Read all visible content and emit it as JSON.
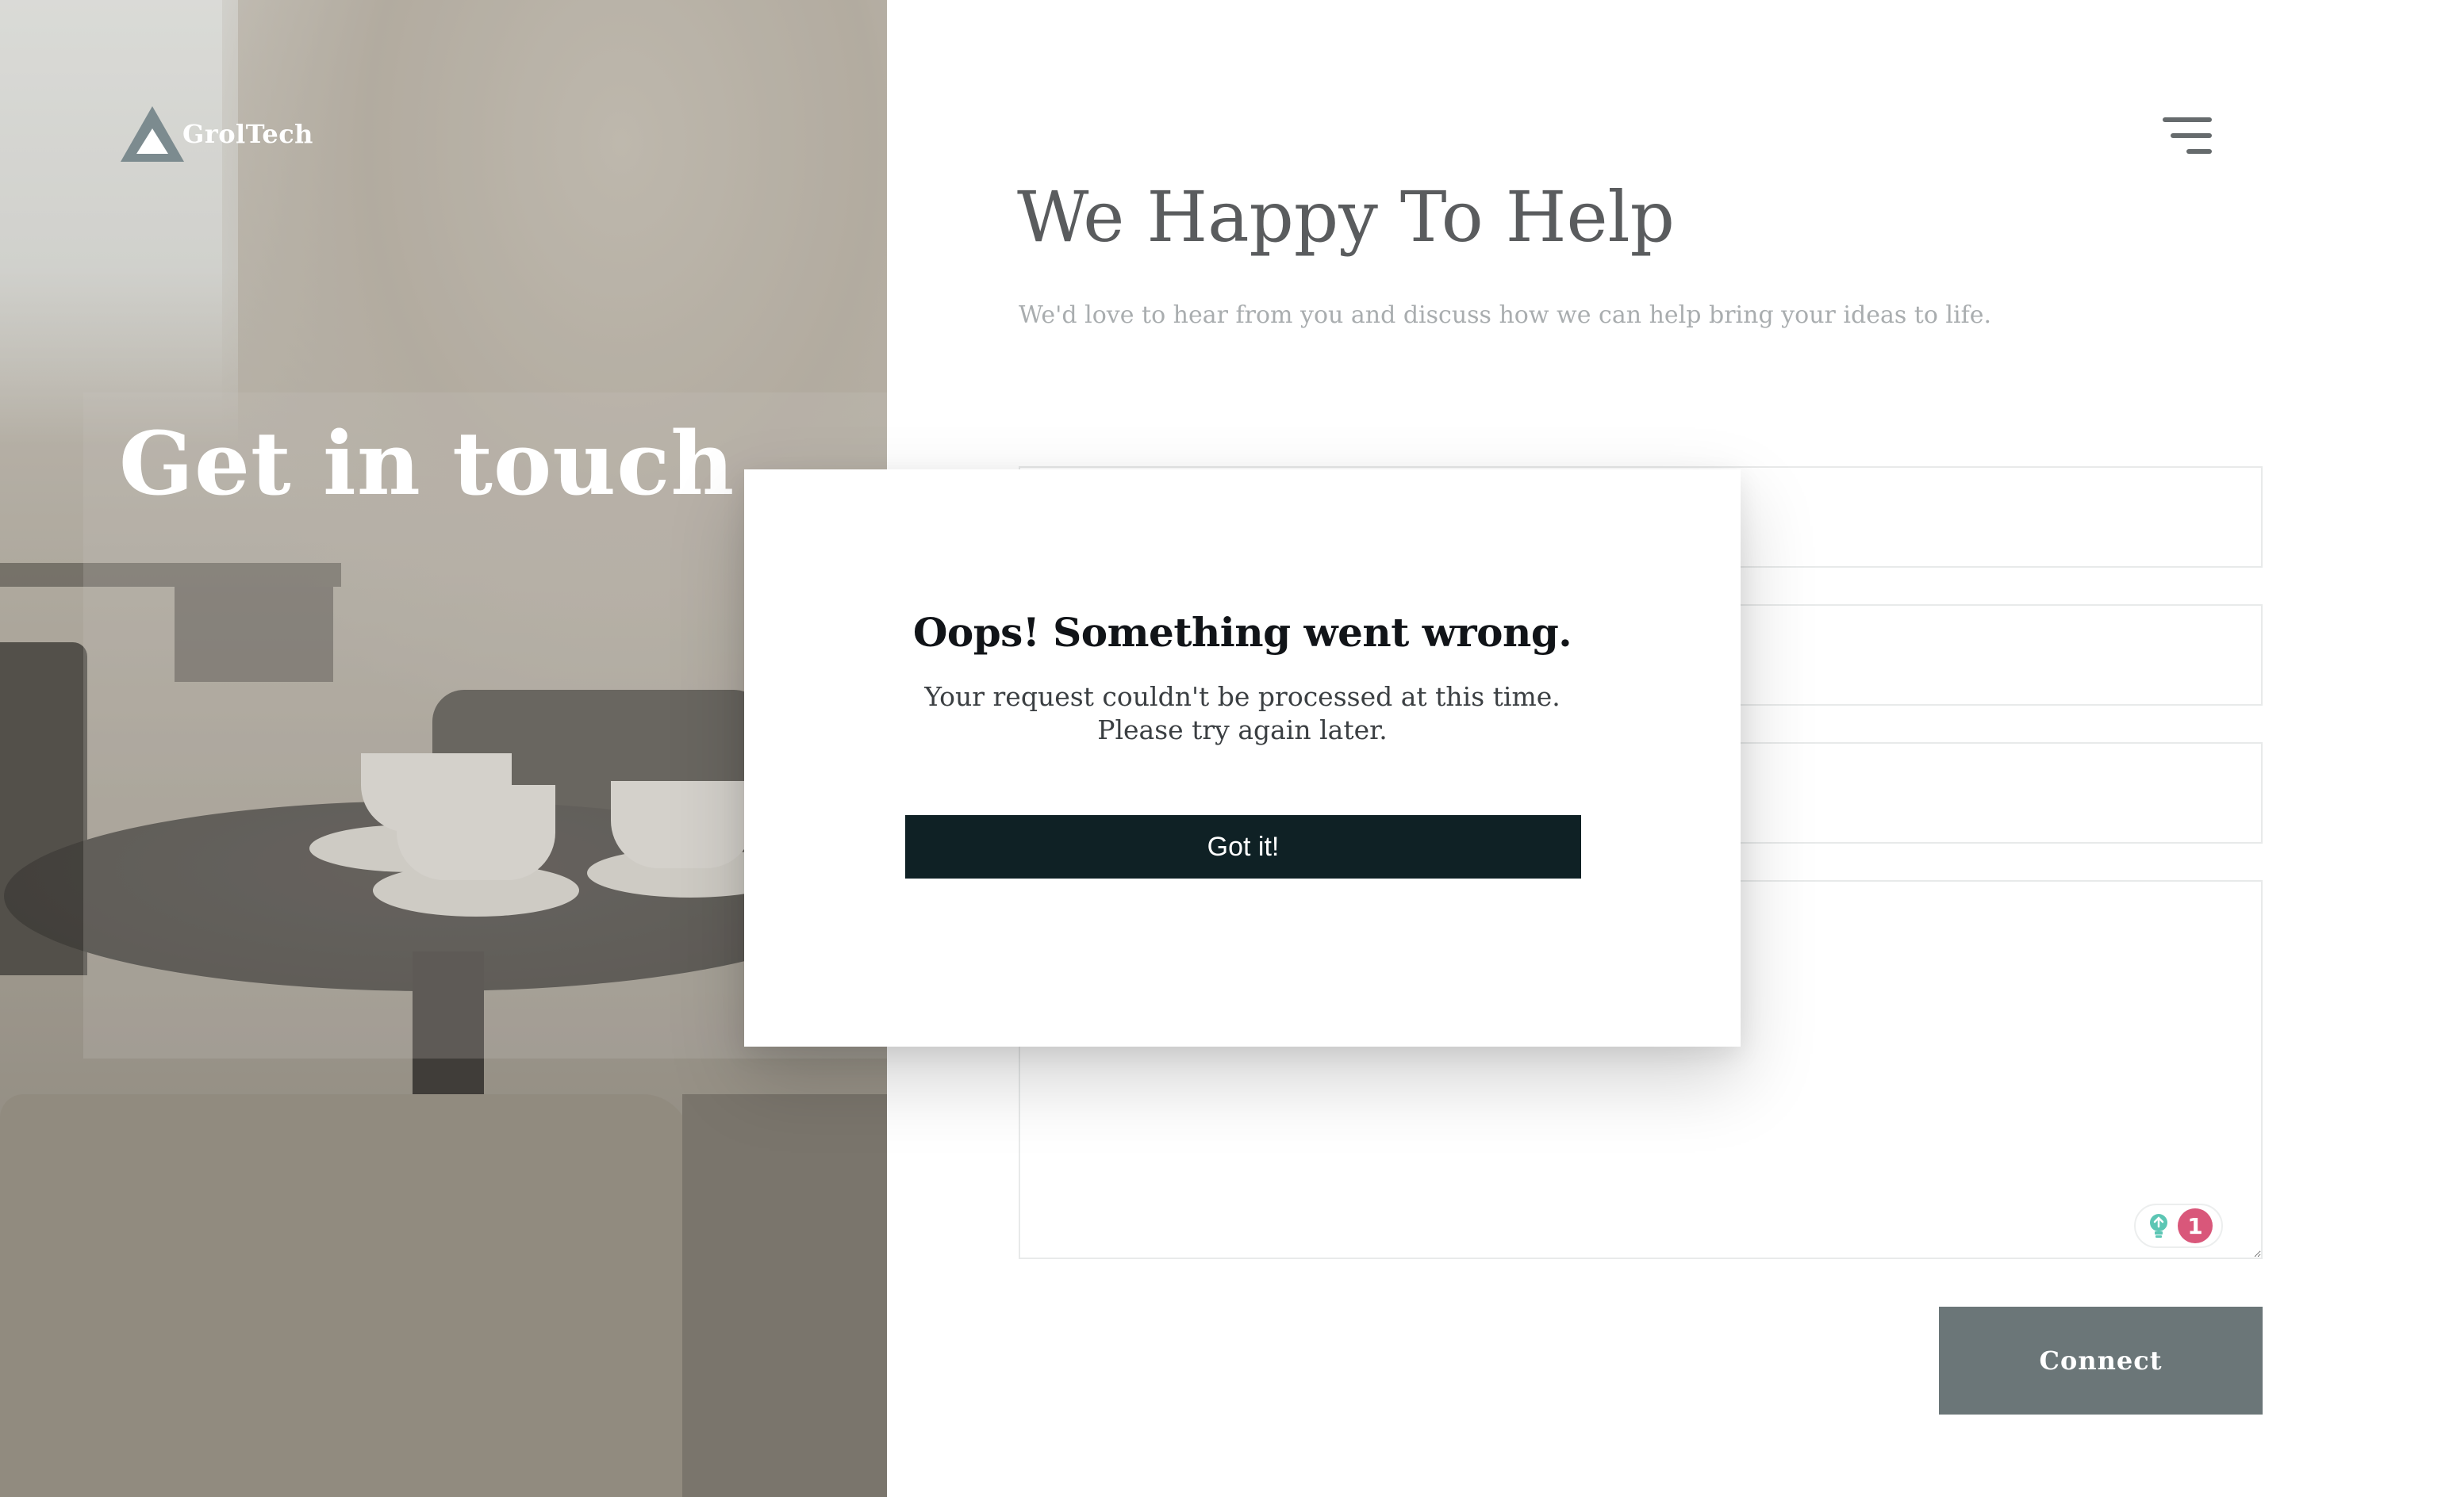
{
  "brand": {
    "name": "GrolTech",
    "logo_icon": "triangle-logo-icon",
    "colors": {
      "logo": "#7c8b8f"
    }
  },
  "hero": {
    "heading": "Get in touch"
  },
  "header": {
    "menu_icon": "hamburger-menu-icon"
  },
  "main": {
    "title": "We Happy To Help",
    "subtitle": "We'd love to hear from you and discuss how we can help bring your ideas to life."
  },
  "form": {
    "fields": [
      {
        "value": "",
        "placeholder": ""
      },
      {
        "value": "",
        "placeholder": ""
      },
      {
        "value": "",
        "placeholder": ""
      }
    ],
    "message": {
      "value": "",
      "placeholder": ""
    },
    "submit_label": "Connect",
    "submit_color": "#6b7678",
    "extension_badge": {
      "icon": "lightbulb-icon",
      "count": "1",
      "count_color": "#d9577a"
    }
  },
  "modal": {
    "title": "Oops! Something went wrong.",
    "message": "Your request couldn't be processed at this time. Please try again later.",
    "button_label": "Got it!",
    "button_color": "#0f2125"
  }
}
